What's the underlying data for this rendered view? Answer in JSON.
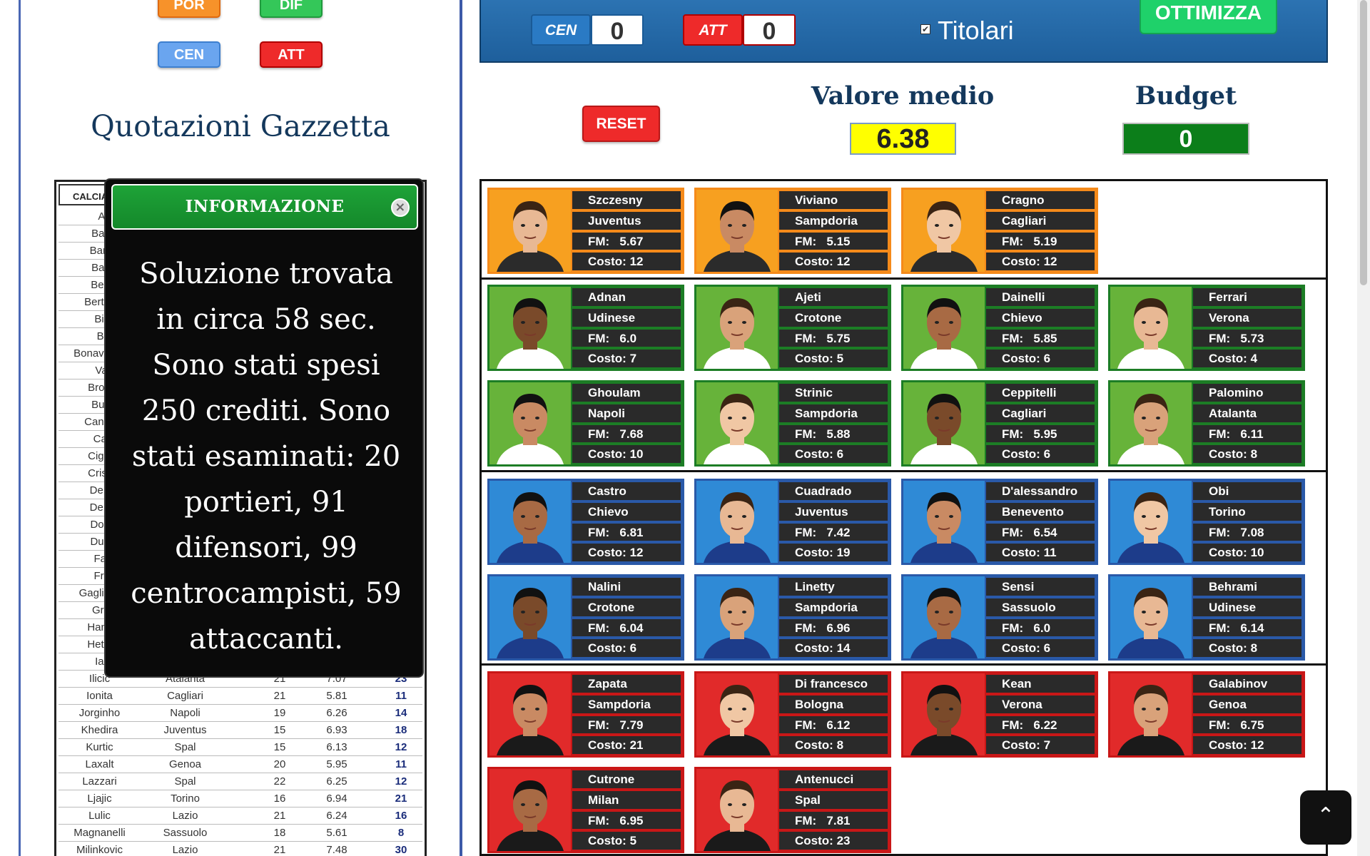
{
  "positions": {
    "por": "POR",
    "dif": "DIF",
    "cen": "CEN",
    "att": "ATT"
  },
  "left": {
    "title": "Quotazioni Gazzetta",
    "table_header": "CALCIA",
    "partial_rows": [
      "All",
      "Bac",
      "Barr",
      "Bas",
      "Ben",
      "Berto",
      "Big",
      "Bir",
      "Bonave",
      "Val",
      "Broz",
      "Buc",
      "Cand",
      "Cat",
      "Ciga",
      "Crist",
      "De r",
      "De r",
      "Don",
      "Dun",
      "Far",
      "Fre",
      "Gaglia",
      "Gra",
      "Ham",
      "Hete",
      "Iag"
    ],
    "rows": [
      {
        "name": "Ilicic",
        "team": "Atalanta",
        "pg": "21",
        "fm": "7.07",
        "cost": "23"
      },
      {
        "name": "Ionita",
        "team": "Cagliari",
        "pg": "21",
        "fm": "5.81",
        "cost": "11"
      },
      {
        "name": "Jorginho",
        "team": "Napoli",
        "pg": "19",
        "fm": "6.26",
        "cost": "14"
      },
      {
        "name": "Khedira",
        "team": "Juventus",
        "pg": "15",
        "fm": "6.93",
        "cost": "18"
      },
      {
        "name": "Kurtic",
        "team": "Spal",
        "pg": "15",
        "fm": "6.13",
        "cost": "12"
      },
      {
        "name": "Laxalt",
        "team": "Genoa",
        "pg": "20",
        "fm": "5.95",
        "cost": "11"
      },
      {
        "name": "Lazzari",
        "team": "Spal",
        "pg": "22",
        "fm": "6.25",
        "cost": "12"
      },
      {
        "name": "Ljajic",
        "team": "Torino",
        "pg": "16",
        "fm": "6.94",
        "cost": "21"
      },
      {
        "name": "Lulic",
        "team": "Lazio",
        "pg": "21",
        "fm": "6.24",
        "cost": "16"
      },
      {
        "name": "Magnanelli",
        "team": "Sassuolo",
        "pg": "18",
        "fm": "5.61",
        "cost": "8"
      },
      {
        "name": "Milinkovic",
        "team": "Lazio",
        "pg": "21",
        "fm": "7.48",
        "cost": "30"
      }
    ]
  },
  "modal": {
    "title": "INFORMAZIONE",
    "close": "×",
    "message": "Soluzione trovata in circa 58 sec. Sono stati spesi 250 crediti. Sono stati esaminati: 20 portieri, 91 difensori, 99 centrocampisti, 59 attaccanti."
  },
  "topbar": {
    "cen_label": "CEN",
    "cen_value": "0",
    "att_label": "ATT",
    "att_value": "0",
    "titolari_label": "Titolari",
    "titolari_check": "✔",
    "ottimizza": "OTTIMIZZA"
  },
  "controls": {
    "reset": "RESET",
    "valore_medio_label": "Valore medio",
    "valore_medio": "6.38",
    "budget_label": "Budget",
    "budget": "0"
  },
  "fm_prefix": "FM:",
  "cost_prefix": "Costo:",
  "players": [
    {
      "role": "por",
      "name": "Szczesny",
      "team": "Juventus",
      "fm": "5.67",
      "cost": "12"
    },
    {
      "role": "por",
      "name": "Viviano",
      "team": "Sampdoria",
      "fm": "5.15",
      "cost": "12"
    },
    {
      "role": "por",
      "name": "Cragno",
      "team": "Cagliari",
      "fm": "5.19",
      "cost": "12"
    },
    {
      "role": "dif",
      "name": "Adnan",
      "team": "Udinese",
      "fm": "6.0",
      "cost": "7"
    },
    {
      "role": "dif",
      "name": "Ajeti",
      "team": "Crotone",
      "fm": "5.75",
      "cost": "5"
    },
    {
      "role": "dif",
      "name": "Dainelli",
      "team": "Chievo",
      "fm": "5.85",
      "cost": "6"
    },
    {
      "role": "dif",
      "name": "Ferrari",
      "team": "Verona",
      "fm": "5.73",
      "cost": "4"
    },
    {
      "role": "dif",
      "name": "Ghoulam",
      "team": "Napoli",
      "fm": "7.68",
      "cost": "10"
    },
    {
      "role": "dif",
      "name": "Strinic",
      "team": "Sampdoria",
      "fm": "5.88",
      "cost": "6"
    },
    {
      "role": "dif",
      "name": "Ceppitelli",
      "team": "Cagliari",
      "fm": "5.95",
      "cost": "6"
    },
    {
      "role": "dif",
      "name": "Palomino",
      "team": "Atalanta",
      "fm": "6.11",
      "cost": "8"
    },
    {
      "role": "cen",
      "name": "Castro",
      "team": "Chievo",
      "fm": "6.81",
      "cost": "12"
    },
    {
      "role": "cen",
      "name": "Cuadrado",
      "team": "Juventus",
      "fm": "7.42",
      "cost": "19"
    },
    {
      "role": "cen",
      "name": "D'alessandro",
      "team": "Benevento",
      "fm": "6.54",
      "cost": "11"
    },
    {
      "role": "cen",
      "name": "Obi",
      "team": "Torino",
      "fm": "7.08",
      "cost": "10"
    },
    {
      "role": "cen",
      "name": "Nalini",
      "team": "Crotone",
      "fm": "6.04",
      "cost": "6"
    },
    {
      "role": "cen",
      "name": "Linetty",
      "team": "Sampdoria",
      "fm": "6.96",
      "cost": "14"
    },
    {
      "role": "cen",
      "name": "Sensi",
      "team": "Sassuolo",
      "fm": "6.0",
      "cost": "6"
    },
    {
      "role": "cen",
      "name": "Behrami",
      "team": "Udinese",
      "fm": "6.14",
      "cost": "8"
    },
    {
      "role": "att",
      "name": "Zapata",
      "team": "Sampdoria",
      "fm": "7.79",
      "cost": "21"
    },
    {
      "role": "att",
      "name": "Di francesco",
      "team": "Bologna",
      "fm": "6.12",
      "cost": "8"
    },
    {
      "role": "att",
      "name": "Kean",
      "team": "Verona",
      "fm": "6.22",
      "cost": "7"
    },
    {
      "role": "att",
      "name": "Galabinov",
      "team": "Genoa",
      "fm": "6.75",
      "cost": "12"
    },
    {
      "role": "att",
      "name": "Cutrone",
      "team": "Milan",
      "fm": "6.95",
      "cost": "5"
    },
    {
      "role": "att",
      "name": "Antenucci",
      "team": "Spal",
      "fm": "7.81",
      "cost": "23"
    }
  ],
  "scroll_top_icon": "chevron-up-icon",
  "colors": {
    "por": "#f7a020",
    "dif": "#67b33a",
    "cen": "#2f8ad6",
    "att": "#e12a2a",
    "header_blue": "#14385c",
    "budget_green": "#0c7e1a",
    "valore_yellow": "#ffff00"
  }
}
